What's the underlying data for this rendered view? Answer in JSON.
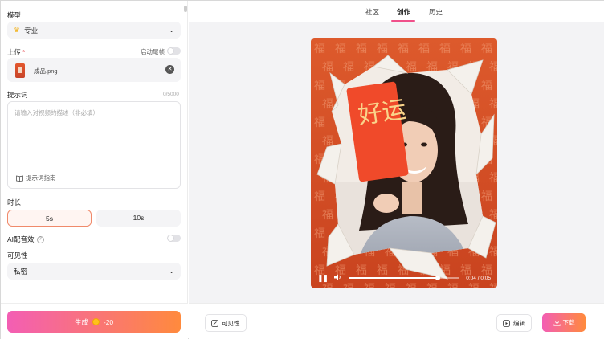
{
  "left": {
    "model_label": "模型",
    "model_value": "专业",
    "upload_label": "上传",
    "upload_required": "*",
    "start_end_frame_label": "启动尾帧",
    "uploaded_file": "成品.png",
    "prompt_label": "提示词",
    "prompt_counter": "0/5000",
    "prompt_placeholder": "请输入对视频的描述（非必填）",
    "prompt_guide": "提示词指南",
    "duration_label": "时长",
    "duration_options": [
      "5s",
      "10s"
    ],
    "duration_selected": "5s",
    "ai_sound_label": "AI配音效",
    "ai_sound_help": "?",
    "visibility_label": "可见性",
    "visibility_value": "私密",
    "generate_label": "生成",
    "generate_cost": "-20"
  },
  "tabs": [
    "社区",
    "创作",
    "历史"
  ],
  "active_tab": "创作",
  "player": {
    "time_current": "0:04",
    "time_total": "0:05",
    "progress": 0.8,
    "watermark_char": "福",
    "envelope_text": "好运"
  },
  "toolbar": {
    "visibility_button": "可见性",
    "edit_button": "编辑",
    "download_button": "下载"
  },
  "colors": {
    "accent_pink": "#f35eb4",
    "accent_orange": "#ff8a3d",
    "selected_border": "#f08a6b",
    "tab_underline": "#f0508a",
    "video_bg": "#d6532b"
  },
  "icons": {
    "model": "crown-icon",
    "remove_file": "close-icon",
    "guide": "book-icon",
    "coin": "coin-icon",
    "pause": "pause-icon",
    "volume": "volume-icon",
    "visibility": "visibility-icon",
    "edit": "edit-icon",
    "download": "download-icon"
  }
}
